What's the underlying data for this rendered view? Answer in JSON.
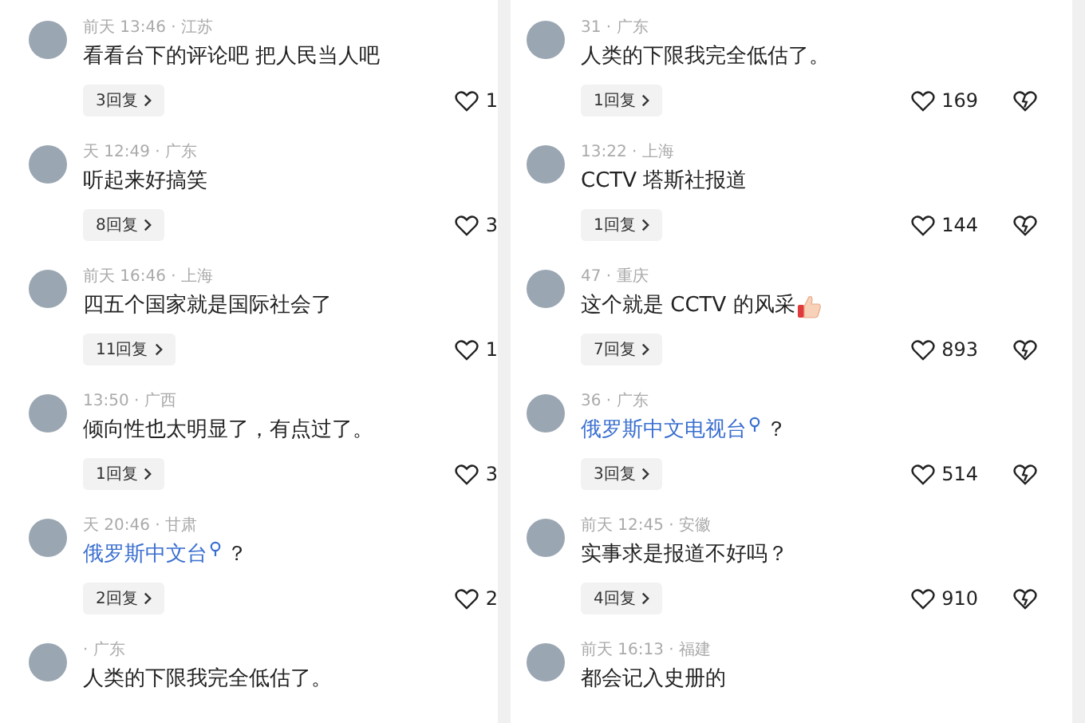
{
  "panels": [
    {
      "comments": [
        {
          "meta": "前天 13:46 · 江苏",
          "kind": "text",
          "text": "看看台下的评论吧 把人民当人吧",
          "replies": "3回复",
          "likes": "1"
        },
        {
          "meta": "天 12:49 · 广东",
          "kind": "text",
          "text": "听起来好搞笑",
          "replies": "8回复",
          "likes": "3"
        },
        {
          "meta": "前天 16:46 · 上海",
          "kind": "text",
          "text": "四五个国家就是国际社会了",
          "replies": "11回复",
          "likes": "1"
        },
        {
          "meta": "13:50 · 广西",
          "kind": "text",
          "text": "倾向性也太明显了，有点过了。",
          "replies": "1回复",
          "likes": "3"
        },
        {
          "meta": "天 20:46 · 甘肃",
          "kind": "mention",
          "text": "俄罗斯中文台",
          "suffix": "？",
          "replies": "2回复",
          "likes": "2"
        },
        {
          "meta": "· 广东",
          "kind": "text",
          "text": "人类的下限我完全低估了。"
        }
      ]
    },
    {
      "comments": [
        {
          "meta": "31 · 广东",
          "kind": "text",
          "text": "人类的下限我完全低估了。",
          "replies": "1回复",
          "likes": "169"
        },
        {
          "meta": "13:22 · 上海",
          "kind": "text",
          "text": "CCTV 塔斯社报道",
          "replies": "1回复",
          "likes": "144"
        },
        {
          "meta": "47 · 重庆",
          "kind": "emoji",
          "text": "这个就是 CCTV 的风采",
          "replies": "7回复",
          "likes": "893"
        },
        {
          "meta": "36 · 广东",
          "kind": "mention",
          "text": "俄罗斯中文电视台",
          "suffix": "？",
          "replies": "3回复",
          "likes": "514"
        },
        {
          "meta": "前天 12:45 · 安徽",
          "kind": "text",
          "text": "实事求是报道不好吗？",
          "replies": "4回复",
          "likes": "910"
        },
        {
          "meta": "前天 16:13 · 福建",
          "kind": "text",
          "text": "都会记入史册的"
        }
      ]
    }
  ]
}
